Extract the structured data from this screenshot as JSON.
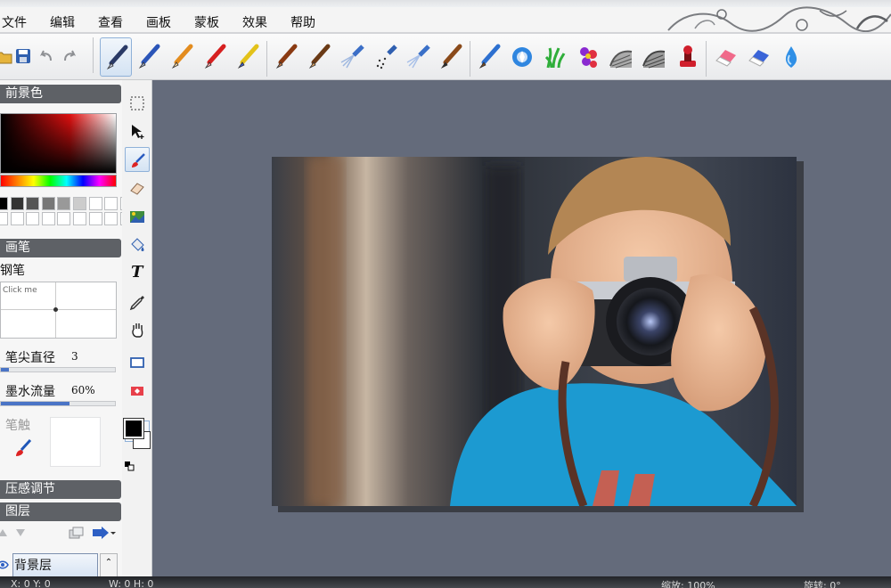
{
  "menubar": {
    "items": [
      "文件",
      "编辑",
      "查看",
      "画板",
      "蒙板",
      "效果",
      "帮助"
    ]
  },
  "toolbar": {
    "file_icons": [
      "open-folder-icon",
      "save-disk-icon",
      "undo-arrow-icon",
      "redo-arrow-icon"
    ],
    "tools": [
      "technical-pen-icon",
      "fountain-pen-icon",
      "pencil-icon",
      "crayon-icon",
      "marker-icon",
      "oil-brush-icon",
      "paint-brush-icon",
      "airbrush-icon",
      "spray-dots-icon",
      "spray-nozzle-icon",
      "flat-brush-icon",
      "paint-bucket-brush-icon",
      "blur-droplet-icon",
      "grass-brush-icon",
      "flower-stamp-icon",
      "texture-mesh-icon",
      "texture-wave-icon",
      "rubber-stamp-icon",
      "eraser-pink-icon",
      "eraser-blue-icon",
      "water-drop-icon"
    ],
    "selected_tool": 0
  },
  "colors": {
    "panel_header": "#5e6166",
    "canvas_bg": "#646b7b",
    "selection_border": "#8fb1d8",
    "slider_fill": "#4a74c6",
    "foreground": "#000000",
    "background": "#ffffff"
  },
  "panel": {
    "foreground_title": "前景色",
    "brush_title": "画笔",
    "brush_name": "钢笔",
    "preview_placeholder": "Click me",
    "tip_size_label": "笔尖直径",
    "tip_size_value": "3",
    "tip_size_fraction": 0.07,
    "ink_flow_label": "墨水流量",
    "ink_flow_value": "60%",
    "ink_flow_fraction": 0.6,
    "brush_touch_label": "笔触",
    "pressure_title": "压感调节",
    "layers_title": "图层",
    "layer_name": "背景层",
    "swatches_row1": [
      "#000000",
      "#333333",
      "#555555",
      "#777777",
      "#999999",
      "#cccccc",
      "#ffffff",
      "#ffffff",
      "#ffffff"
    ],
    "swatches_row2": [
      "#ffffff",
      "#ffffff",
      "#ffffff",
      "#ffffff",
      "#ffffff",
      "#ffffff",
      "#ffffff",
      "#ffffff",
      "#ffffff"
    ]
  },
  "tools_column": {
    "items": [
      "marquee-select-icon",
      "move-arrow-icon",
      "brush-tool-icon",
      "eraser-tool-icon",
      "fill-image-icon",
      "paint-bucket-icon",
      "text-tool-icon",
      "eyedropper-icon",
      "hand-pan-icon",
      "rect-shape-icon",
      "rect-fill-icon"
    ],
    "selected_index": 2,
    "text_tool_glyph": "T"
  },
  "statusbar": {
    "coords": "X: 0 Y: 0",
    "size": "W: 0 H: 0",
    "zoom": "缩放: 100%",
    "rotate": "旋转: 0°"
  }
}
